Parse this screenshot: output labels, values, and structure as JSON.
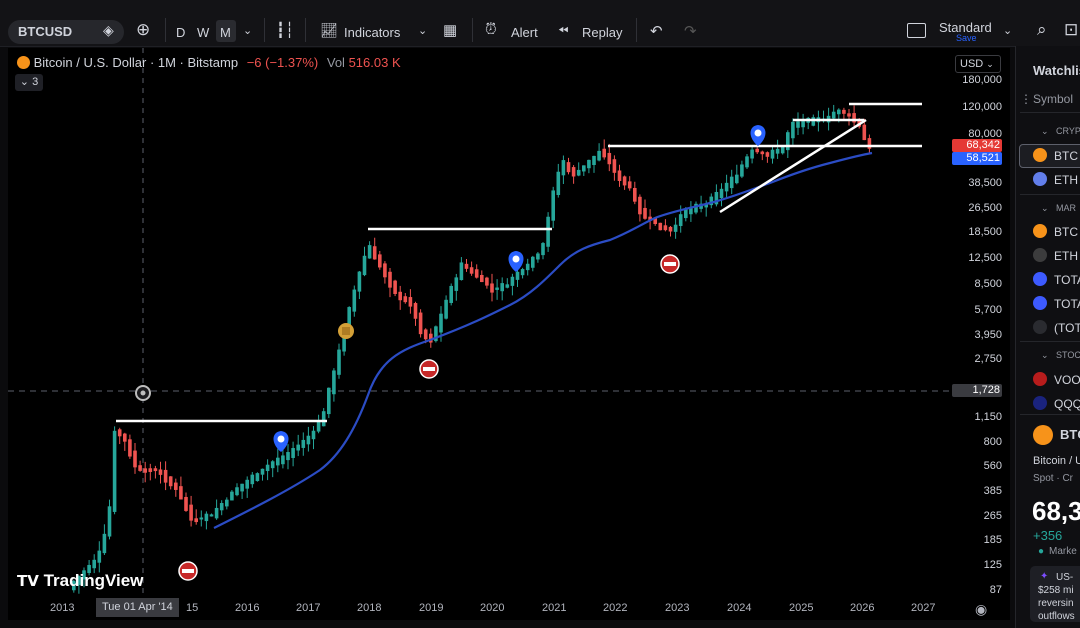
{
  "toolbar": {
    "symbol": "BTCUSD",
    "intervals": [
      "D",
      "W",
      "M"
    ],
    "indicators_label": "Indicators",
    "alert_label": "Alert",
    "replay_label": "Replay",
    "layout_label": "Standard",
    "save_label": "Save"
  },
  "legend": {
    "title": "Bitcoin / U.S. Dollar · 1M · Bitstamp",
    "change": "−6 (−1.37%)",
    "vol_label": "Vol",
    "vol_value": "516.03 K",
    "collapsed_count": "3"
  },
  "price_axis": {
    "currency": "USD",
    "labels": [
      "180,000",
      "120,000",
      "80,000",
      "38,500",
      "26,500",
      "18,500",
      "12,500",
      "8,500",
      "5,700",
      "3,950",
      "2,750",
      "1,150",
      "800",
      "560",
      "385",
      "265",
      "185",
      "125",
      "87"
    ],
    "price_tag_1": "68,342",
    "price_tag_2": "58,521",
    "crosshair_tag": "1,728"
  },
  "time_axis": {
    "labels": [
      "2013",
      "15",
      "2016",
      "2017",
      "2018",
      "2019",
      "2020",
      "2021",
      "2022",
      "2023",
      "2024",
      "2025",
      "2026",
      "2027"
    ],
    "crosshair_date": "Tue 01 Apr '14"
  },
  "brand": "TradingView",
  "watchlist": {
    "title": "Watchlis",
    "symbol_header": "Symbol",
    "section_crypto": "CRYP",
    "section_markets": "MAR",
    "section_stocks": "STOC",
    "items": [
      "BTC",
      "ETH",
      "BTC",
      "ETH",
      "TOTA",
      "TOTA",
      "(TOT",
      "VOO",
      "QQQ"
    ],
    "detail_symbol": "BTC",
    "detail_name": "Bitcoin / U",
    "detail_type": "Spot · Cr",
    "detail_price": "68,3",
    "detail_change": "+356",
    "detail_market": "Marke",
    "news_title": "US-",
    "news_line1": "$258 mi",
    "news_line2": "reversin",
    "news_line3": "outflows"
  },
  "colors": {
    "up": "#26a69a",
    "down": "#ef5350",
    "ma": "#2b4cc4",
    "bitcoin": "#f7931a",
    "tag_red": "#e53935",
    "tag_blue": "#2962ff"
  }
}
